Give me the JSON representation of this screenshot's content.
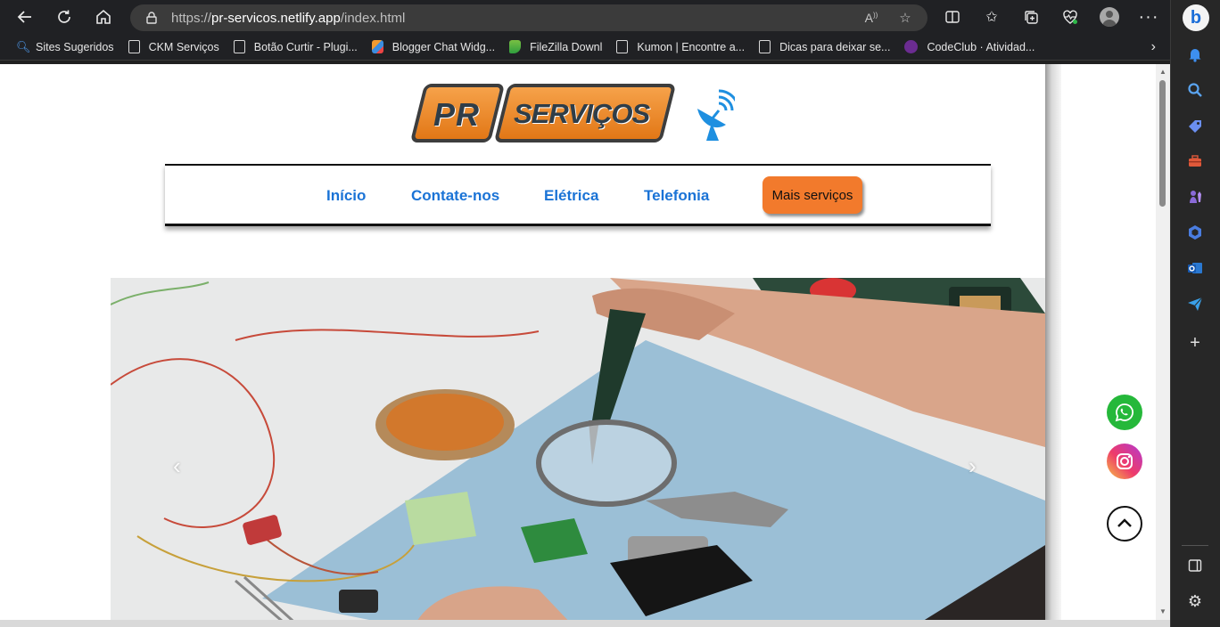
{
  "browser": {
    "url_prefix": "https://",
    "url_host": "pr-servicos.netlify.app",
    "url_path": "/index.html"
  },
  "bookmarks": [
    {
      "label": "Sites Sugeridos",
      "icon": "search-icon"
    },
    {
      "label": "CKM Serviços",
      "icon": "page-icon"
    },
    {
      "label": "Botão Curtir - Plugi...",
      "icon": "page-icon"
    },
    {
      "label": "Blogger Chat Widg...",
      "icon": "people-icon"
    },
    {
      "label": "FileZilla Downl",
      "icon": "filezilla-icon"
    },
    {
      "label": "Kumon | Encontre a...",
      "icon": "page-icon"
    },
    {
      "label": "Dicas para deixar se...",
      "icon": "page-icon"
    },
    {
      "label": "CodeClub · Atividad...",
      "icon": "codeclub-icon"
    }
  ],
  "logo": {
    "part1": "PR",
    "part2": "SERVIÇOS"
  },
  "nav": {
    "inicio": "Início",
    "contato": "Contate-nos",
    "eletrica": "Elétrica",
    "telefonia": "Telefonia",
    "mais": "Mais serviços"
  },
  "carousel": {
    "prev": "‹",
    "next": "›"
  },
  "colors": {
    "accent_orange": "#f27a2c",
    "nav_link_blue": "#1a73d6",
    "whatsapp_green": "#25b83a",
    "browser_dark": "#202124"
  }
}
